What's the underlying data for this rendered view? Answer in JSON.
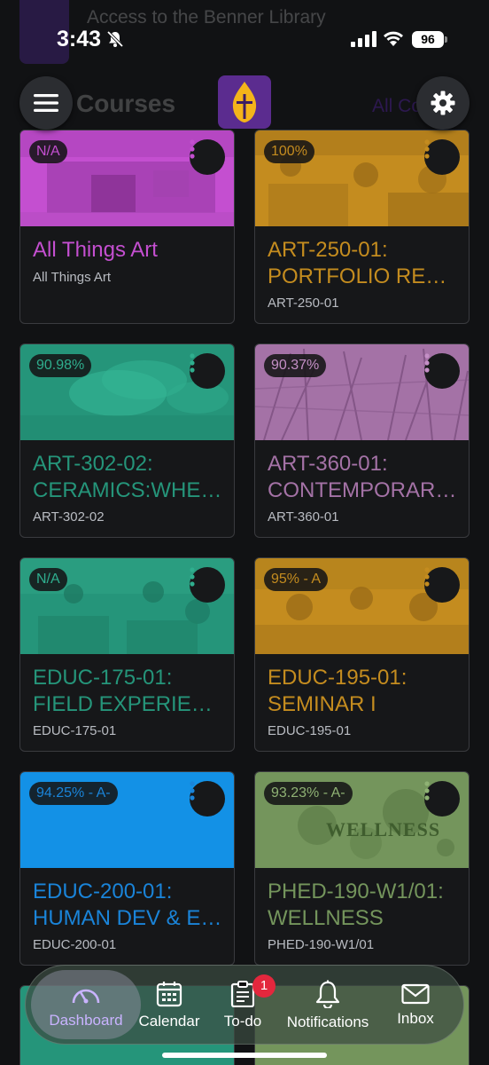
{
  "status": {
    "time": "3:43",
    "battery": "96"
  },
  "banner": {
    "text": "Access to the Benner Library"
  },
  "header": {
    "title_partial": "Courses",
    "all_label": "All Courses"
  },
  "colors": {
    "art": "#c44fd0",
    "art250": "#c48c1f",
    "teal": "#25957a",
    "mauve": "#a472a6",
    "blue": "#1a84d9",
    "green": "#74955c",
    "accent": "#c9b3ff"
  },
  "courses": [
    {
      "grade": "N/A",
      "title1": "All Things Art",
      "title2": "",
      "code": "All Things Art",
      "color": "#c44fd0"
    },
    {
      "grade": "100%",
      "title1": "ART-250-01:",
      "title2": "PORTFOLIO REV…",
      "code": "ART-250-01",
      "color": "#c48c1f"
    },
    {
      "grade": "90.98%",
      "title1": "ART-302-02:",
      "title2": "CERAMICS:WHE…",
      "code": "ART-302-02",
      "color": "#25957a"
    },
    {
      "grade": "90.37%",
      "title1": "ART-360-01:",
      "title2": "CONTEMPORAR…",
      "code": "ART-360-01",
      "color": "#a472a6"
    },
    {
      "grade": "N/A",
      "title1": "EDUC-175-01:",
      "title2": "FIELD EXPERIEN…",
      "code": "EDUC-175-01",
      "color": "#25957a"
    },
    {
      "grade": "95% - A",
      "title1": "EDUC-195-01:",
      "title2": "SEMINAR I",
      "code": "EDUC-195-01",
      "color": "#c48c1f"
    },
    {
      "grade": "94.25% - A-",
      "title1": "EDUC-200-01:",
      "title2": "HUMAN DEV & E…",
      "code": "EDUC-200-01",
      "color": "#1a84d9"
    },
    {
      "grade": "93.23% - A-",
      "title1": "PHED-190-W1/01:",
      "title2": "WELLNESS",
      "code": "PHED-190-W1/01",
      "color": "#74955c",
      "image_text": "WELLNESS"
    }
  ],
  "nav": {
    "dashboard": "Dashboard",
    "calendar": "Calendar",
    "todo": "To-do",
    "todo_badge": "1",
    "notifications": "Notifications",
    "inbox": "Inbox"
  }
}
